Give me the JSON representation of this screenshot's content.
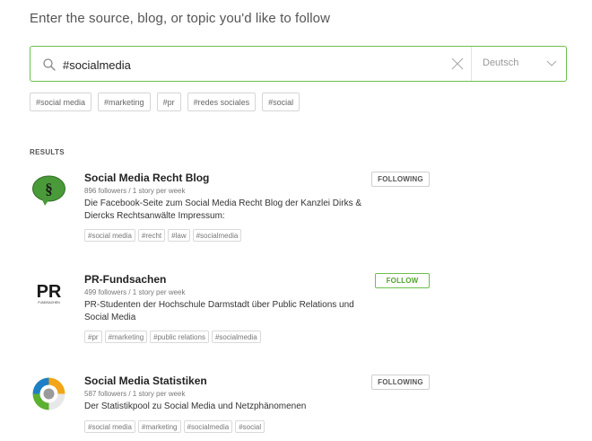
{
  "heading": "Enter the source, blog, or topic you'd like to follow",
  "search": {
    "value": "#socialmedia",
    "language": "Deutsch"
  },
  "suggestions": [
    "#social media",
    "#marketing",
    "#pr",
    "#redes sociales",
    "#social"
  ],
  "results_label": "RESULTS",
  "results": [
    {
      "title": "Social Media Recht Blog",
      "meta": "896 followers / 1 story per week",
      "description": "Die Facebook-Seite zum Social Media Recht Blog der Kanzlei Dirks & Diercks Rechtsanwälte Impressum:",
      "tags": [
        "#social media",
        "#recht",
        "#law",
        "#socialmedia"
      ],
      "button": "FOLLOWING",
      "logo": "section-sign-icon"
    },
    {
      "title": "PR-Fundsachen",
      "meta": "499 followers / 1 story per week",
      "description": "PR-Studenten der Hochschule Darmstadt über Public Relations und Social Media",
      "tags": [
        "#pr",
        "#marketing",
        "#public relations",
        "#socialmedia"
      ],
      "button": "FOLLOW",
      "logo": "pr-logo",
      "logo_text": "PR",
      "logo_subtext": "FUNDSACHEN"
    },
    {
      "title": "Social Media Statistiken",
      "meta": "587 followers / 1 story per week",
      "description": "Der Statistikpool zu Social Media und Netzphänomenen",
      "tags": [
        "#social media",
        "#marketing",
        "#socialmedia",
        "#social"
      ],
      "button": "FOLLOWING",
      "logo": "donut-chart-icon"
    }
  ],
  "colors": {
    "accent": "#6cc04a",
    "logo_green": "#4a9a3a"
  }
}
